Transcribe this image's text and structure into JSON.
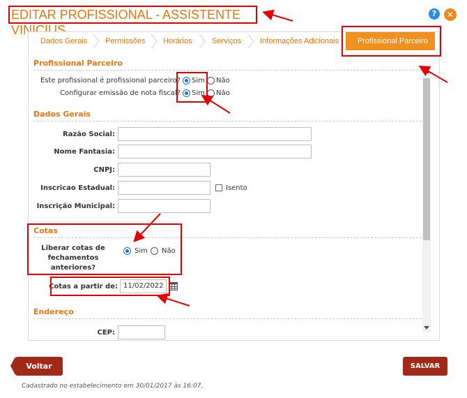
{
  "window": {
    "title": "EDITAR PROFISSIONAL - ASSISTENTE VINICIUS",
    "help_glyph": "?",
    "close_glyph": "✕"
  },
  "tabs": [
    {
      "label": "Dados Gerais"
    },
    {
      "label": "Permissões"
    },
    {
      "label": "Horários"
    },
    {
      "label": "Serviços"
    },
    {
      "label": "Informações Adicionais"
    },
    {
      "label": "Profissional Parceiro",
      "active": true
    }
  ],
  "parceiro": {
    "section_title": "Profissional Parceiro",
    "q1_label": "Este profissional é profissional parceiro?",
    "q2_label": "Configurar emissão de nota fiscal?",
    "opt_sim": "Sim",
    "opt_nao": "Não",
    "q1_value": "Sim",
    "q2_value": "Sim"
  },
  "dados_gerais": {
    "section_title": "Dados Gerais",
    "razao_social_label": "Razão Social:",
    "razao_social_value": "",
    "nome_fantasia_label": "Nome Fantasia:",
    "nome_fantasia_value": "",
    "cnpj_label": "CNPJ:",
    "cnpj_value": "",
    "inscricao_estadual_label": "Inscricao Estadual:",
    "inscricao_estadual_value": "",
    "isento_label": "Isento",
    "isento_checked": false,
    "inscricao_municipal_label": "Inscrição Municipal:",
    "inscricao_municipal_value": ""
  },
  "cotas": {
    "section_title": "Cotas",
    "liberar_label": "Liberar cotas de fechamentos anteriores?",
    "liberar_line1": "Liberar cotas de",
    "liberar_line2": "fechamentos",
    "liberar_line3": "anteriores?",
    "opt_sim": "Sim",
    "opt_nao": "Não",
    "liberar_value": "Sim",
    "a_partir_label": "Cotas a partir de:",
    "a_partir_value": "11/02/2022"
  },
  "endereco": {
    "section_title": "Endereço",
    "cep_label": "CEP:",
    "cep_value": ""
  },
  "actions": {
    "back_label": "Voltar",
    "save_label": "SALVAR"
  },
  "footer": {
    "text": "Cadastrado no estabelecimento em 30/01/2017 às 16:07."
  },
  "colors": {
    "accent": "#e8760e",
    "tab_active_bg": "#f0901e",
    "button_bg": "#a02a17",
    "annotation_red": "#e20000"
  }
}
